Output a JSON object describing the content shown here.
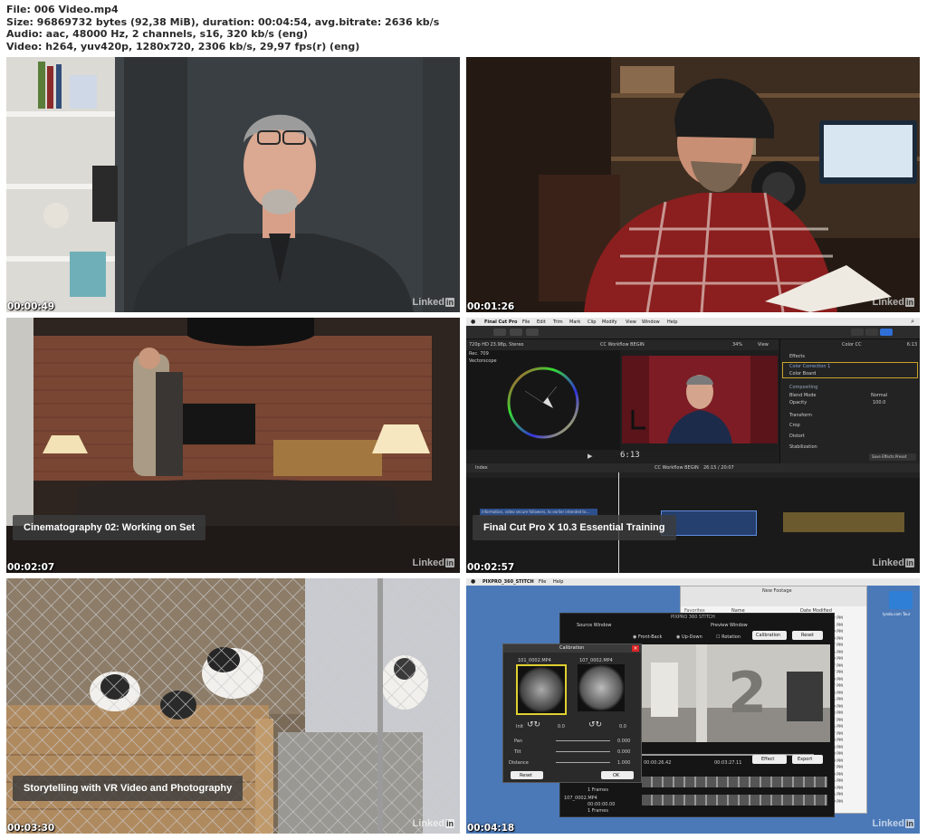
{
  "meta": {
    "file": "File: 006 Video.mp4",
    "size": "Size: 96869732 bytes (92,38 MiB), duration: 00:04:54, avg.bitrate: 2636 kb/s",
    "audio": "Audio: aac, 48000 Hz, 2 channels, s16, 320 kb/s (eng)",
    "video": "Video: h264, yuv420p, 1280x720, 2306 kb/s, 29,97 fps(r) (eng)"
  },
  "brand": {
    "text": "Linked",
    "badge": "in"
  },
  "thumbs": [
    {
      "time": "00:00:49"
    },
    {
      "time": "00:01:26"
    },
    {
      "time": "00:02:07",
      "caption": "Cinematography 02: Working on Set"
    },
    {
      "time": "00:02:57",
      "caption": "Final Cut Pro X 10.3 Essential Training"
    },
    {
      "time": "00:03:30",
      "caption": "Storytelling with VR Video and Photography"
    },
    {
      "time": "00:04:18"
    }
  ],
  "fcp": {
    "menu": [
      "Final Cut Pro",
      "File",
      "Edit",
      "Trim",
      "Mark",
      "Clip",
      "Modify",
      "View",
      "Window",
      "Help"
    ],
    "format": "720p HD 23.98p, Stereo",
    "project": "CC Workflow BEGIN",
    "zoom": "34%",
    "view": "View",
    "scope": "Rec. 709",
    "scope_label": "Vectorscope",
    "inspector_title": "Color CC",
    "inspector_time": "6:13",
    "effects_label": "Effects",
    "color_correction": "Color Correction 1",
    "color_board": "Color Board",
    "compositing": "Compositing",
    "blend_mode": "Blend Mode",
    "blend_value": "Normal",
    "opacity": "Opacity",
    "opacity_value": "100.0",
    "transform": "Transform",
    "crop": "Crop",
    "distort": "Distort",
    "stabilization": "Stabilization",
    "save_preset": "Save Effects Preset",
    "timecode": "6:13",
    "index": "Index",
    "timeline_info": "CC Workflow BEGIN",
    "timeline_dur": "26:15 / 20:07",
    "clip_label": "information, video secure followers, to earlier intended to..."
  },
  "pixpro": {
    "menu": [
      "PIXPRO_360_STITCH",
      "File",
      "Help"
    ],
    "title": "PIXPRO 360 STITCH",
    "source_window": "Source Window",
    "preview_window": "Preview Window",
    "front_back": "Front-Back",
    "up_down": "Up-Down",
    "rotation": "Rotation",
    "calibration_btn": "Calibration",
    "reset_btn": "Reset",
    "calibration_title": "Calibration",
    "left_file": "101_0002.MP4",
    "right_file": "107_0002.MP4",
    "zoom_left": "0.0",
    "zoom_right": "0.0",
    "zoom_label": "Init",
    "pan": "Pan",
    "tilt": "Tilt",
    "distance": "Distance",
    "pan_value": "0.000",
    "tilt_value": "0.000",
    "distance_value": "1.000",
    "cal_reset": "Reset",
    "cal_ok": "OK",
    "time_start": "00:00:26.42",
    "time_end": "00:03:27.11",
    "effect_btn": "Effect",
    "export_btn": "Export",
    "big_number": "2",
    "file_frames": "1 Frames",
    "file_name": "107_0002.MP4",
    "file_time": "00:00:00.00",
    "file_frames2": "1 Frames",
    "finder_title": "New Footage",
    "finder_name_col": "Name",
    "finder_date_col": "Date Modified",
    "finder_side": "Favorites",
    "desktop_folder": "lynda.com Tour",
    "finder_times": [
      "2 PM",
      "1 PM",
      "9 PM",
      "9 PM",
      "7 PM",
      "5 PM",
      "9 PM",
      "7 PM",
      "7 PM",
      "9 PM",
      "7 PM",
      "8 PM",
      "5 PM",
      "9 PM",
      "8 PM",
      "7 PM",
      "5 PM",
      "7 PM",
      "8 PM",
      "8 PM",
      "9 PM",
      "9 PM",
      "7 PM",
      "9 PM",
      "5 PM",
      "9 PM",
      "6 PM",
      "9 PM"
    ]
  }
}
